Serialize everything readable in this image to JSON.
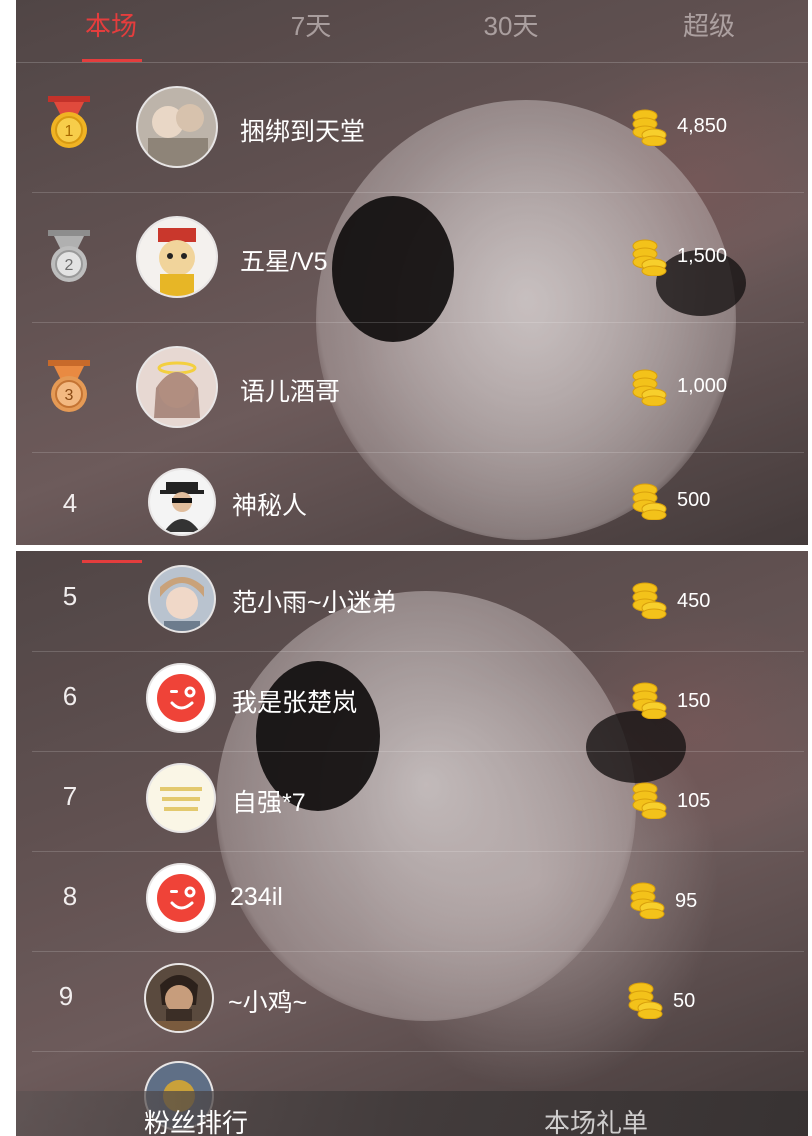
{
  "tabs": [
    {
      "label": "本场",
      "active": true
    },
    {
      "label": "7天",
      "active": false
    },
    {
      "label": "30天",
      "active": false
    },
    {
      "label": "超级",
      "active": false
    }
  ],
  "top_entries": [
    {
      "rank": 1,
      "medal": "gold-medal",
      "name": "捆绑到天堂",
      "amount": "4,850"
    },
    {
      "rank": 2,
      "medal": "silver-medal",
      "name": "五星/V5",
      "amount": "1,500"
    },
    {
      "rank": 3,
      "medal": "bronze-medal",
      "name": "语儿酒哥",
      "amount": "1,000"
    },
    {
      "rank": "4",
      "name": "神秘人",
      "amount": "500"
    }
  ],
  "list_entries": [
    {
      "rank": "5",
      "name": "范小雨~小迷弟",
      "amount": "450"
    },
    {
      "rank": "6",
      "name": "我是张楚岚",
      "amount": "150"
    },
    {
      "rank": "7",
      "name": "自强*7",
      "amount": "105"
    },
    {
      "rank": "8",
      "name": "234il",
      "amount": "95"
    },
    {
      "rank": "9",
      "name": "~小鸡~",
      "amount": "50"
    }
  ],
  "bottom_tabs": {
    "left": "粉丝排行",
    "right": "本场礼单"
  },
  "colors": {
    "accent": "#e43d3d",
    "coin": "#f3c21a",
    "gold": "#e8b020",
    "silver": "#c8c8c8",
    "bronze": "#e59a55"
  },
  "icons": {
    "coin": "gold-coin-stack-icon",
    "default_avatar": "red-wink-face-icon"
  }
}
